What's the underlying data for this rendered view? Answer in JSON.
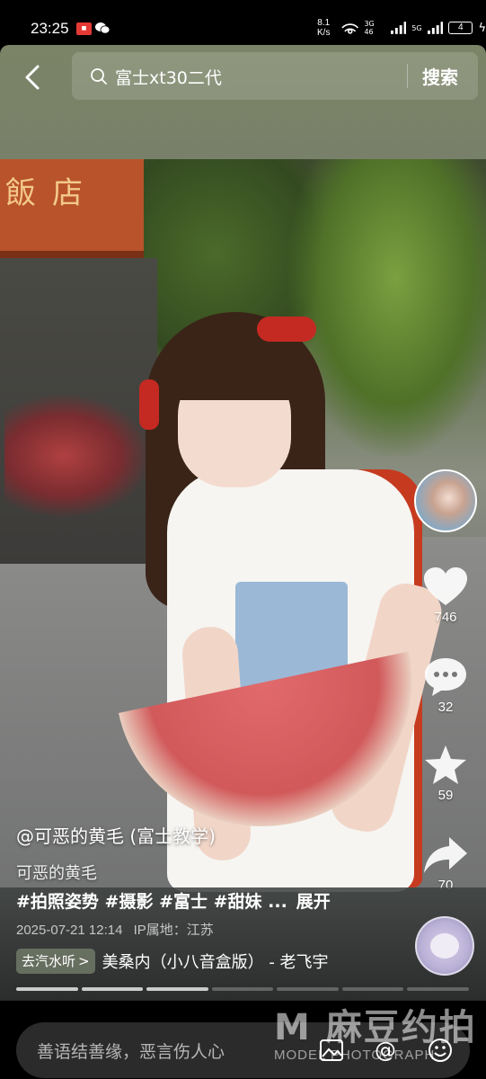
{
  "status_bar": {
    "time": "23:25",
    "net_speed_value": "8.1",
    "net_speed_unit": "K/s",
    "signal_1": "3G 46",
    "signal_2": "5G",
    "battery": "4"
  },
  "header": {
    "search_query": "富士xt30二代",
    "search_button": "搜索"
  },
  "photo": {
    "sign_text": "飯店"
  },
  "rail": {
    "like_count": "746",
    "comment_count": "32",
    "favorite_count": "59",
    "share_count": "70"
  },
  "caption": {
    "author": "@可恶的黄毛 (富士教学)",
    "subname": "可恶的黄毛",
    "tags": "#拍照姿势 #摄影 #富士 #甜妹 ...",
    "expand": "展开",
    "date": "2025-07-21 12:14",
    "ip_label": "IP属地：江苏"
  },
  "music": {
    "chip_label": "去汽水听",
    "chevron": ">",
    "title": "美桑内（小八音盒版） - 老飞宇"
  },
  "progress": {
    "segments": 7,
    "completed": 3
  },
  "comment_bar": {
    "placeholder": "善语结善缘，恶言伤人心"
  },
  "watermark": {
    "main": "M 麻豆约拍",
    "sub": "MODEL PHOTOGRAPH"
  },
  "colors": {
    "header_bg": "#7b8466",
    "accent_red": "#c42a22",
    "comment_box": "#2b2b2b"
  }
}
